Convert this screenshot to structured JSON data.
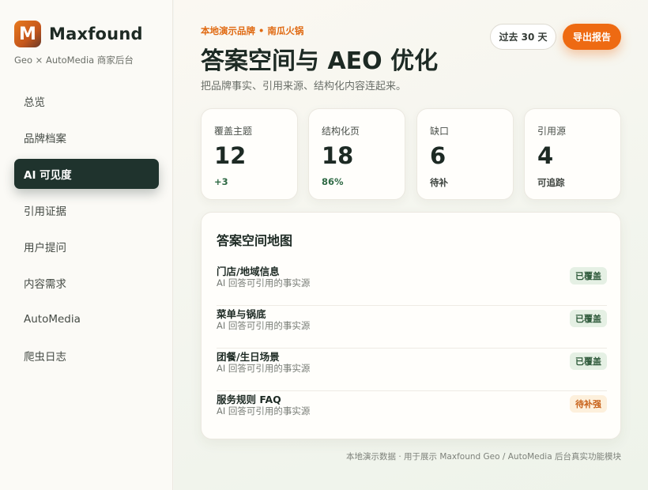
{
  "brand": {
    "logo_letter": "M",
    "name": "Maxfound",
    "subtitle": "Geo × AutoMedia 商家后台"
  },
  "nav": {
    "items": [
      {
        "label": "总览",
        "active": false
      },
      {
        "label": "品牌档案",
        "active": false
      },
      {
        "label": "AI 可见度",
        "active": true
      },
      {
        "label": "引用证据",
        "active": false
      },
      {
        "label": "用户提问",
        "active": false
      },
      {
        "label": "内容需求",
        "active": false
      },
      {
        "label": "AutoMedia",
        "active": false
      },
      {
        "label": "爬虫日志",
        "active": false
      }
    ]
  },
  "header": {
    "eyebrow": "本地演示品牌 • 南瓜火锅",
    "title": "答案空间与 AEO 优化",
    "subtitle": "把品牌事实、引用来源、结构化内容连起来。",
    "range_label": "过去 30 天",
    "export_label": "导出报告"
  },
  "stats": [
    {
      "label": "覆盖主题",
      "value": "12",
      "note": "+3"
    },
    {
      "label": "结构化页",
      "value": "18",
      "note": "86%"
    },
    {
      "label": "缺口",
      "value": "6",
      "note": "待补"
    },
    {
      "label": "引用源",
      "value": "4",
      "note": "可追踪"
    }
  ],
  "answer_map": {
    "title": "答案空间地图",
    "rows": [
      {
        "name": "门店/地域信息",
        "desc": "AI 回答可引用的事实源",
        "status": "已覆盖",
        "status_type": "ok"
      },
      {
        "name": "菜单与锅底",
        "desc": "AI 回答可引用的事实源",
        "status": "已覆盖",
        "status_type": "ok"
      },
      {
        "name": "团餐/生日场景",
        "desc": "AI 回答可引用的事实源",
        "status": "已覆盖",
        "status_type": "ok"
      },
      {
        "name": "服务规则 FAQ",
        "desc": "AI 回答可引用的事实源",
        "status": "待补强",
        "status_type": "warn"
      }
    ]
  },
  "footer": {
    "note": "本地演示数据 · 用于展示 Maxfound Geo / AutoMedia 后台真实功能模块"
  },
  "colors": {
    "accent": "#ee6a12",
    "nav_active": "#1f332d",
    "positive": "#2f6a45"
  }
}
